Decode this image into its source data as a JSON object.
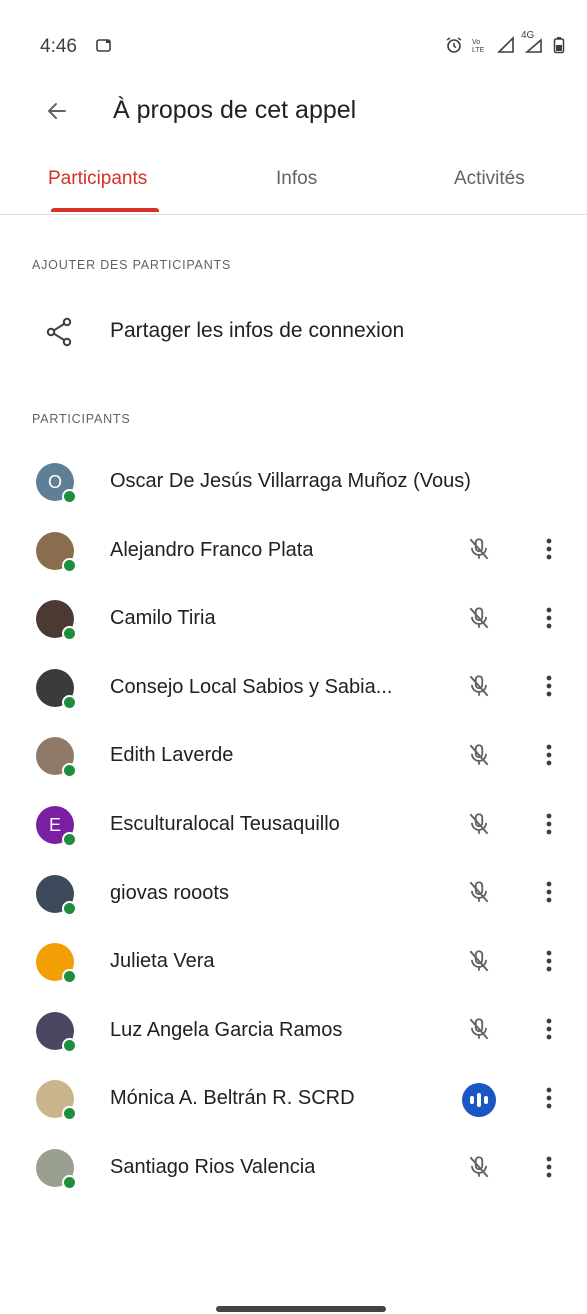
{
  "status_bar": {
    "time": "4:46",
    "network_label": "4G",
    "icons": [
      "cast-icon",
      "alarm-icon",
      "volte-icon",
      "signal-icon",
      "signal-4g-icon",
      "battery-icon"
    ]
  },
  "app_bar": {
    "title": "À propos de cet appel",
    "back_icon": "arrow-back-icon"
  },
  "tabs": [
    {
      "label": "Participants",
      "active": true
    },
    {
      "label": "Infos",
      "active": false
    },
    {
      "label": "Activités",
      "active": false
    }
  ],
  "add_section": {
    "header": "AJOUTER DES PARTICIPANTS",
    "share_label": "Partager les infos de connexion",
    "share_icon": "share-icon"
  },
  "participants_section": {
    "header": "PARTICIPANTS",
    "items": [
      {
        "name": "Oscar De Jesús Villarraga Muñoz (Vous)",
        "initial": "O",
        "avatar_color": "#5f7f96",
        "mic": "none"
      },
      {
        "name": "Alejandro Franco Plata",
        "initial": "",
        "avatar_color": "#8a6d4f",
        "mic": "muted"
      },
      {
        "name": "Camilo Tiria",
        "initial": "",
        "avatar_color": "#4a3a33",
        "mic": "muted"
      },
      {
        "name": "Consejo Local Sabios y Sabia...",
        "initial": "",
        "avatar_color": "#3b3b3b",
        "mic": "muted"
      },
      {
        "name": "Edith Laverde",
        "initial": "",
        "avatar_color": "#8f7a6a",
        "mic": "muted"
      },
      {
        "name": "Esculturalocal Teusaquillo",
        "initial": "E",
        "avatar_color": "#7b1fa2",
        "mic": "muted"
      },
      {
        "name": "giovas rooots",
        "initial": "",
        "avatar_color": "#3d4a5c",
        "mic": "muted"
      },
      {
        "name": "Julieta Vera",
        "initial": "",
        "avatar_color": "#f29f05",
        "mic": "muted"
      },
      {
        "name": "Luz Angela Garcia Ramos",
        "initial": "",
        "avatar_color": "#4a4760",
        "mic": "muted"
      },
      {
        "name": "Mónica A. Beltrán R. SCRD",
        "initial": "",
        "avatar_color": "#c9b48c",
        "mic": "speaking"
      },
      {
        "name": "Santiago Rios Valencia",
        "initial": "",
        "avatar_color": "#9aa08f",
        "mic": "muted"
      }
    ]
  },
  "colors": {
    "accent": "#d93025",
    "online": "#1e8e3e",
    "speaking": "#1a57c4"
  }
}
